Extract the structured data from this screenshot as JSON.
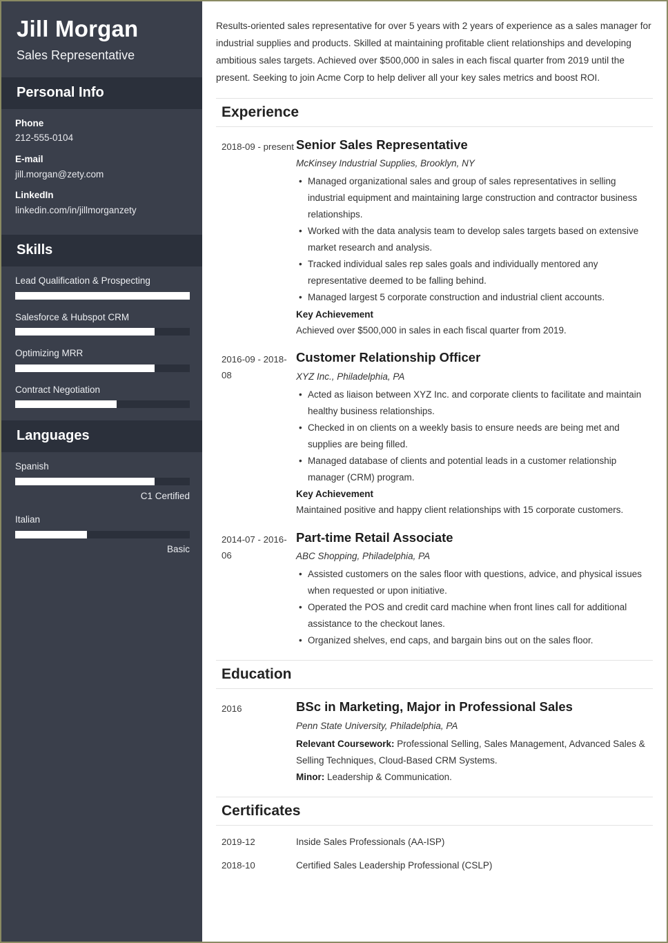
{
  "sidebar": {
    "full_name": "Jill Morgan",
    "job_title": "Sales Representative",
    "personal_info": {
      "heading": "Personal Info",
      "items": [
        {
          "label": "Phone",
          "value": "212-555-0104"
        },
        {
          "label": "E-mail",
          "value": "jill.morgan@zety.com"
        },
        {
          "label": "LinkedIn",
          "value": "linkedin.com/in/jillmorganzety"
        }
      ]
    },
    "skills": {
      "heading": "Skills",
      "items": [
        {
          "label": "Lead Qualification & Prospecting",
          "level": 100
        },
        {
          "label": "Salesforce & Hubspot CRM",
          "level": 80
        },
        {
          "label": "Optimizing MRR",
          "level": 80
        },
        {
          "label": "Contract Negotiation",
          "level": 58
        }
      ]
    },
    "languages": {
      "heading": "Languages",
      "items": [
        {
          "label": "Spanish",
          "level": 80,
          "note": "C1 Certified"
        },
        {
          "label": "Italian",
          "level": 41,
          "note": "Basic"
        }
      ]
    }
  },
  "main": {
    "summary": "Results-oriented sales representative for over 5 years with 2 years of experience as a sales manager for industrial supplies and products. Skilled at maintaining profitable client relationships and developing ambitious sales targets. Achieved over $500,000 in sales in each fiscal quarter from 2019 until the present. Seeking to join Acme Corp to help deliver all your key sales metrics and boost ROI.",
    "experience": {
      "heading": "Experience",
      "entries": [
        {
          "date": "2018-09 - present",
          "title": "Senior Sales Representative",
          "org": "McKinsey Industrial Supplies, Brooklyn, NY",
          "bullets": [
            "Managed organizational sales and group of sales representatives in selling industrial equipment and maintaining large construction and contractor business relationships.",
            "Worked with the data analysis team to develop sales targets based on extensive market research and analysis.",
            "Tracked individual sales rep sales goals and individually mentored any representative deemed to be falling behind.",
            "Managed largest 5 corporate construction and industrial client accounts."
          ],
          "key_achievement_label": "Key Achievement",
          "key_achievement": "Achieved over $500,000 in sales in each fiscal quarter from 2019."
        },
        {
          "date": "2016-09 - 2018-08",
          "title": "Customer Relationship Officer",
          "org": "XYZ Inc., Philadelphia, PA",
          "bullets": [
            "Acted as liaison between XYZ Inc. and corporate clients to facilitate and maintain healthy business relationships.",
            "Checked in on clients on a weekly basis to ensure needs are being met and supplies are being filled.",
            "Managed database of clients and potential leads in a customer relationship manager (CRM) program."
          ],
          "key_achievement_label": "Key Achievement",
          "key_achievement": "Maintained positive and happy client relationships with 15 corporate customers."
        },
        {
          "date": "2014-07 - 2016-06",
          "title": "Part-time Retail Associate",
          "org": "ABC Shopping, Philadelphia, PA",
          "bullets": [
            "Assisted customers on the sales floor with questions, advice, and physical issues when requested or upon initiative.",
            "Operated the POS and credit card machine when front lines call for additional assistance to the checkout lanes.",
            "Organized shelves, end caps, and bargain bins out on the sales floor."
          ],
          "key_achievement_label": "",
          "key_achievement": ""
        }
      ]
    },
    "education": {
      "heading": "Education",
      "date": "2016",
      "title": "BSc in Marketing, Major in Professional Sales",
      "org": "Penn State University, Philadelphia, PA",
      "coursework_label": "Relevant Coursework:",
      "coursework": " Professional Selling, Sales Management, Advanced Sales & Selling Techniques, Cloud-Based CRM Systems.",
      "minor_label": "Minor:",
      "minor": " Leadership & Communication."
    },
    "certificates": {
      "heading": "Certificates",
      "entries": [
        {
          "date": "2019-12",
          "name": "Inside Sales Professionals (AA-ISP)"
        },
        {
          "date": "2018-10",
          "name": "Certified Sales Leadership Professional (CSLP)"
        }
      ]
    }
  },
  "colors": {
    "sidebar_bg": "#3a3f4b",
    "sidebar_header_bg": "#2b303b",
    "page_border": "#8a8a63",
    "bar_fill": "#ffffff",
    "rule": "#e3e3e3"
  }
}
